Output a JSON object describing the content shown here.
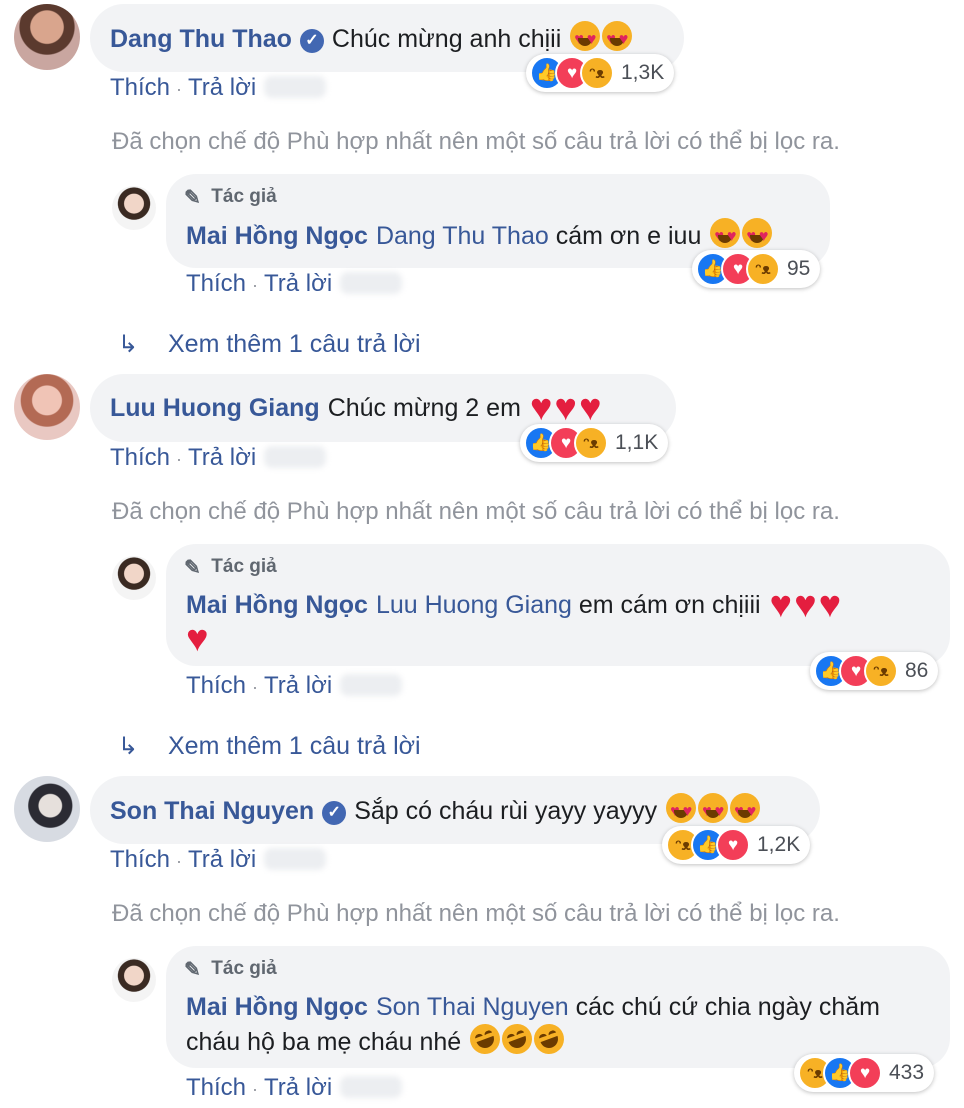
{
  "filter_notice": "Đã chọn chế độ Phù hợp nhất nên một số câu trả lời có thể bị lọc ra.",
  "actions": {
    "like": "Thích",
    "reply": "Trả lời",
    "separator": "·"
  },
  "author_badge": "Tác giả",
  "view_more": "Xem thêm 1 câu trả lời",
  "colors": {
    "link": "#385898",
    "bubble": "#f2f3f5",
    "muted": "#90949c",
    "like": "#1877f2",
    "love": "#f33e58",
    "haha": "#f7b125"
  },
  "comments": [
    {
      "name": "Dang Thu Thao",
      "verified": true,
      "text": "Chúc mừng anh chịii",
      "emoji": [
        "heart-eyes-icon",
        "heart-eyes-icon"
      ],
      "reaction_count": "1,3K",
      "reply": {
        "name": "Mai Hồng Ngọc",
        "tag": "Dang Thu Thao",
        "text": "cám ơn e iuu",
        "emoji": [
          "heart-eyes-icon",
          "heart-eyes-icon"
        ],
        "reaction_count": "95"
      }
    },
    {
      "name": "Luu Huong Giang",
      "verified": false,
      "text": "Chúc mừng 2 em",
      "emoji": [
        "heart-icon",
        "heart-icon",
        "heart-icon"
      ],
      "reaction_count": "1,1K",
      "reply": {
        "name": "Mai Hồng Ngọc",
        "tag": "Luu Huong Giang",
        "text": "em cám ơn chịiii",
        "emoji": [
          "heart-icon",
          "heart-icon",
          "heart-icon",
          "heart-icon"
        ],
        "reaction_count": "86"
      }
    },
    {
      "name": "Son Thai Nguyen",
      "verified": true,
      "text": "Sắp có cháu rùi yayy yayyy",
      "emoji": [
        "heart-eyes-icon",
        "heart-eyes-icon",
        "heart-eyes-icon"
      ],
      "reaction_count": "1,2K",
      "reply": {
        "name": "Mai Hồng Ngọc",
        "tag": "Son Thai Nguyen",
        "text_line1": "các chú cứ chia ngày chăm",
        "text_line2": "cháu hộ ba mẹ cháu nhé",
        "emoji": [
          "rofl-icon",
          "rofl-icon",
          "rofl-icon"
        ],
        "reaction_count": "433"
      }
    }
  ]
}
